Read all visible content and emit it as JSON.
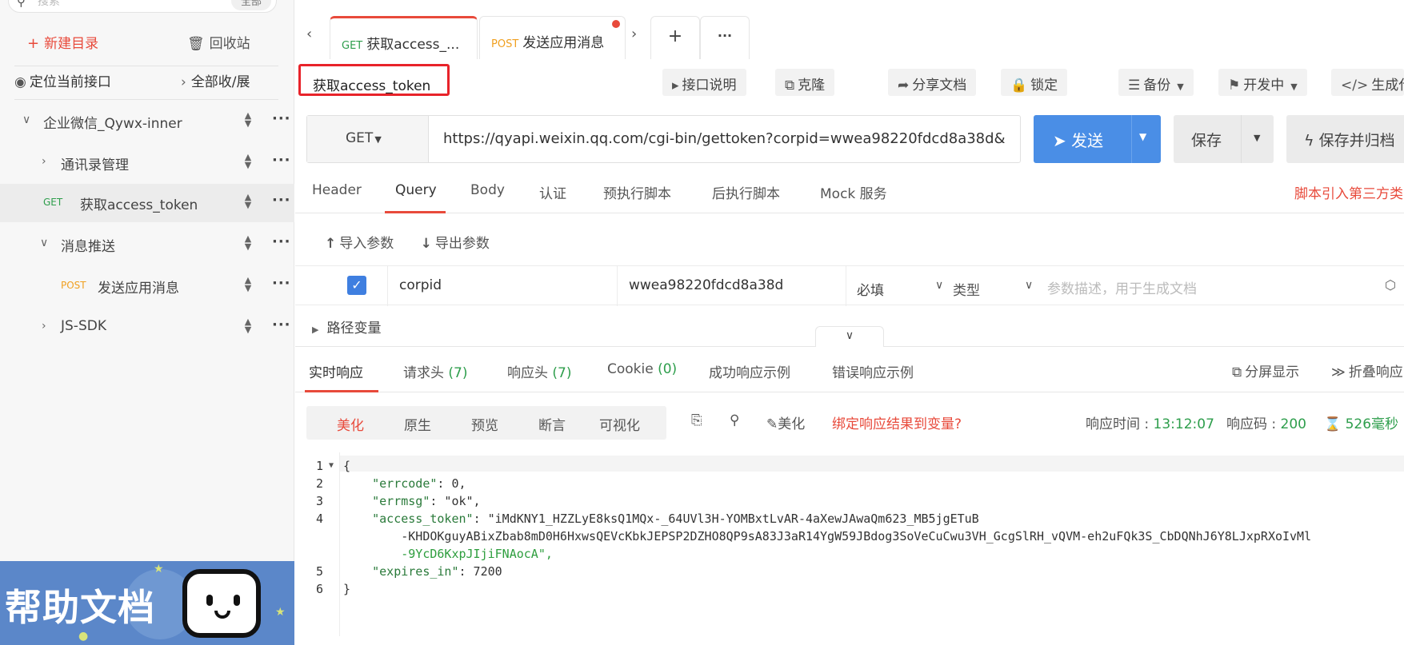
{
  "sidebar": {
    "search_placeholder": "搜索",
    "search_scope": "全部",
    "new_dir": "新建目录",
    "recycle": "回收站",
    "locate": "定位当前接口",
    "collapse_all": "全部收/展",
    "tree": [
      {
        "label": "企业微信_Qywx-inner",
        "method": "",
        "expanded": true
      },
      {
        "label": "通讯录管理",
        "method": "",
        "expanded": false
      },
      {
        "label": "获取access_token",
        "method": "GET",
        "active": true
      },
      {
        "label": "消息推送",
        "method": "",
        "expanded": true
      },
      {
        "label": "发送应用消息",
        "method": "POST"
      },
      {
        "label": "JS-SDK",
        "method": "",
        "expanded": false
      }
    ],
    "help_banner": "帮助文档"
  },
  "tabs": [
    {
      "method": "GET",
      "label": "获取access_...",
      "active": true
    },
    {
      "method": "POST",
      "label": "发送应用消息",
      "unsaved": true
    }
  ],
  "title": "获取access_token",
  "toolbar": {
    "doc": "接口说明",
    "clone": "克隆",
    "share": "分享文档",
    "lock": "锁定",
    "backup": "备份",
    "status": "开发中",
    "gen_code": "生成代"
  },
  "request": {
    "method": "GET",
    "url": "https://qyapi.weixin.qq.com/cgi-bin/gettoken?corpid=wwea98220fdcd8a38d&",
    "send": "发送",
    "save": "保存",
    "save_archive": "保存并归档"
  },
  "req_tabs": [
    "Header",
    "Query",
    "Body",
    "认证",
    "预执行脚本",
    "后执行脚本",
    "Mock 服务"
  ],
  "script_note": "脚本引入第三方类",
  "params": {
    "import": "导入参数",
    "export": "导出参数",
    "rows": [
      {
        "checked": true,
        "key": "corpid",
        "value": "wwea98220fdcd8a38d",
        "required": "必填",
        "type": "类型",
        "desc_placeholder": "参数描述，用于生成文档"
      }
    ],
    "path_vars": "路径变量"
  },
  "response": {
    "tabs": [
      {
        "label": "实时响应",
        "count": ""
      },
      {
        "label": "请求头",
        "count": "(7)"
      },
      {
        "label": "响应头",
        "count": "(7)"
      },
      {
        "label": "Cookie",
        "count": "(0)"
      },
      {
        "label": "成功响应示例",
        "count": ""
      },
      {
        "label": "错误响应示例",
        "count": ""
      }
    ],
    "split_view": "分屏显示",
    "fold": "折叠响应",
    "views": [
      "美化",
      "原生",
      "预览",
      "断言",
      "可视化"
    ],
    "beautify": "美化",
    "bind_var": "绑定响应结果到变量?",
    "time_label": "响应时间 : ",
    "time": "13:12:07",
    "code_label": "响应码 : ",
    "code": "200",
    "duration": "526毫秒",
    "body_lines": [
      "{",
      "    \"errcode\": 0,",
      "    \"errmsg\": \"ok\",",
      "    \"access_token\": \"iMdKNY1_HZZLyE8ksQ1MQx-_64UVl3H-YOMBxtLvAR-4aXewJAwaQm623_MB5jgETuB",
      "        -KHDOKguyABixZbab8mD0H6HxwsQEVcKbkJEPSP2DZHO8QP9sA83J3aR14YgW59JBdog3SoVeCuCwu3VH_GcgSlRH_vQVM-eh2uFQk3S_CbDQNhJ6Y8LJxpRXoIvMl",
      "        -9YcD6KxpJIjiFNAocA\",",
      "    \"expires_in\": 7200",
      "}"
    ],
    "line_numbers": [
      "1",
      "2",
      "3",
      "4",
      "5",
      "6"
    ]
  },
  "colors": {
    "accent": "#e84a3b",
    "primary": "#4a8ee6",
    "get": "#2e9e4c",
    "post": "#f0a020"
  }
}
